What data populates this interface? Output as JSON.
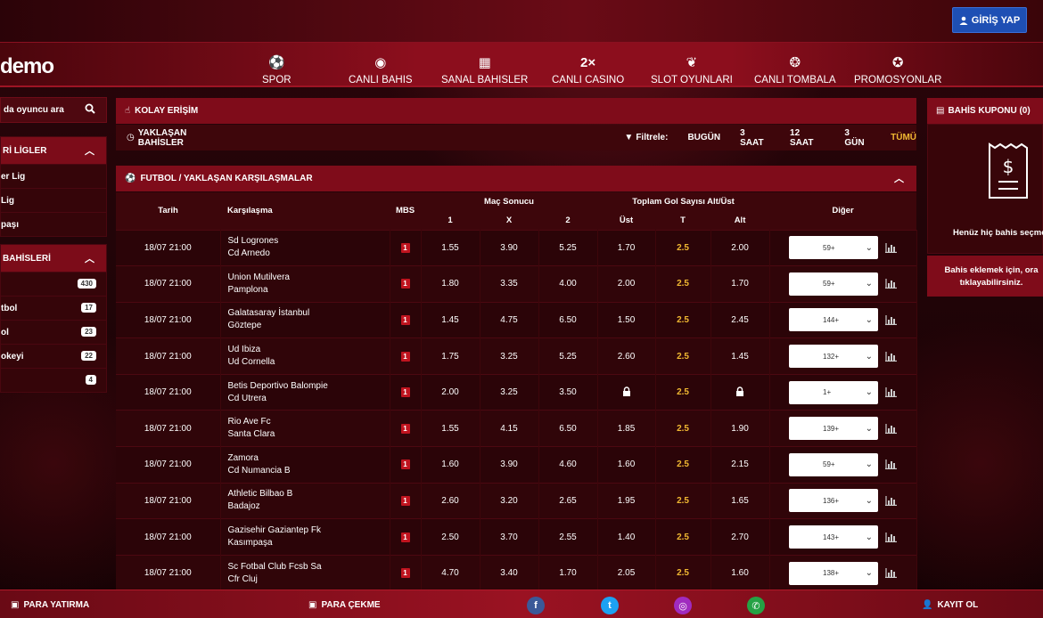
{
  "header": {
    "login_label": "GİRİŞ YAP",
    "logo_text": "demo"
  },
  "nav": {
    "items": [
      {
        "label": "SPOR",
        "icon": "soccer-ball-icon"
      },
      {
        "label": "CANLI BAHIS",
        "icon": "live-icon"
      },
      {
        "label": "SANAL BAHISLER",
        "icon": "virtual-icon"
      },
      {
        "label": "CANLI CASINO",
        "icon": "2x-icon"
      },
      {
        "label": "SLOT OYUNLARI",
        "icon": "cherry-icon"
      },
      {
        "label": "CANLI TOMBALA",
        "icon": "balls-icon"
      },
      {
        "label": "PROMOSYONLAR",
        "icon": "gift-icon"
      }
    ]
  },
  "sidebar": {
    "search_text": "da oyuncu ara",
    "leagues_title": "Rİ LİGLER",
    "leagues": [
      "er Lig",
      "Lig",
      "paşı"
    ],
    "bets_title": "BAHİSLERİ",
    "sports": [
      {
        "label": "",
        "count": "430"
      },
      {
        "label": "tbol",
        "count": "17"
      },
      {
        "label": "ol",
        "count": "23"
      },
      {
        "label": "okeyi",
        "count": "22"
      },
      {
        "label": "",
        "count": "4"
      }
    ]
  },
  "quick_access": {
    "title": "KOLAY ERİŞİM"
  },
  "upcoming": {
    "title": "YAKLAŞAN BAHİSLER",
    "filter_label": "Filtrele:",
    "filters": [
      "BUGÜN",
      "3 SAAT",
      "12 SAAT",
      "3 GÜN",
      "TÜMÜ"
    ],
    "active_filter": "TÜMÜ"
  },
  "matches_panel": {
    "title": "FUTBOL / YAKLAŞAN KARŞILAŞMALAR",
    "headers": {
      "date": "Tarih",
      "match": "Karşılaşma",
      "mbs": "MBS",
      "result": "Maç Sonucu",
      "r1": "1",
      "rx": "X",
      "r2": "2",
      "total": "Toplam Gol Sayısı Alt/Üst",
      "over": "Üst",
      "t": "T",
      "under": "Alt",
      "other": "Diğer"
    },
    "rows": [
      {
        "date": "18/07 21:00",
        "home": "Sd Logrones",
        "away": "Cd Arnedo",
        "mbs": "1",
        "o1": "1.55",
        "ox": "3.90",
        "o2": "5.25",
        "over": "1.70",
        "t": "2.5",
        "under": "2.00",
        "more": "59+"
      },
      {
        "date": "18/07 21:00",
        "home": "Union Mutilvera",
        "away": "Pamplona",
        "mbs": "1",
        "o1": "1.80",
        "ox": "3.35",
        "o2": "4.00",
        "over": "2.00",
        "t": "2.5",
        "under": "1.70",
        "more": "59+"
      },
      {
        "date": "18/07 21:00",
        "home": "Galatasaray İstanbul",
        "away": "Göztepe",
        "mbs": "1",
        "o1": "1.45",
        "ox": "4.75",
        "o2": "6.50",
        "over": "1.50",
        "t": "2.5",
        "under": "2.45",
        "more": "144+"
      },
      {
        "date": "18/07 21:00",
        "home": "Ud Ibiza",
        "away": "Ud Cornella",
        "mbs": "1",
        "o1": "1.75",
        "ox": "3.25",
        "o2": "5.25",
        "over": "2.60",
        "t": "2.5",
        "under": "1.45",
        "more": "132+"
      },
      {
        "date": "18/07 21:00",
        "home": "Betis Deportivo Balompie",
        "away": "Cd Utrera",
        "mbs": "1",
        "o1": "2.00",
        "ox": "3.25",
        "o2": "3.50",
        "over": "",
        "t": "2.5",
        "under": "",
        "more": "1+",
        "locked": true
      },
      {
        "date": "18/07 21:00",
        "home": "Rio Ave Fc",
        "away": "Santa Clara",
        "mbs": "1",
        "o1": "1.55",
        "ox": "4.15",
        "o2": "6.50",
        "over": "1.85",
        "t": "2.5",
        "under": "1.90",
        "more": "139+"
      },
      {
        "date": "18/07 21:00",
        "home": "Zamora",
        "away": "Cd Numancia B",
        "mbs": "1",
        "o1": "1.60",
        "ox": "3.90",
        "o2": "4.60",
        "over": "1.60",
        "t": "2.5",
        "under": "2.15",
        "more": "59+"
      },
      {
        "date": "18/07 21:00",
        "home": "Athletic Bilbao B",
        "away": "Badajoz",
        "mbs": "1",
        "o1": "2.60",
        "ox": "3.20",
        "o2": "2.65",
        "over": "1.95",
        "t": "2.5",
        "under": "1.65",
        "more": "136+"
      },
      {
        "date": "18/07 21:00",
        "home": "Gazisehir Gaziantep Fk",
        "away": "Kasımpaşa",
        "mbs": "1",
        "o1": "2.50",
        "ox": "3.70",
        "o2": "2.55",
        "over": "1.40",
        "t": "2.5",
        "under": "2.70",
        "more": "143+"
      },
      {
        "date": "18/07 21:00",
        "home": "Sc Fotbal Club Fcsb Sa",
        "away": "Cfr Cluj",
        "mbs": "1",
        "o1": "4.70",
        "ox": "3.40",
        "o2": "1.70",
        "over": "2.05",
        "t": "2.5",
        "under": "1.60",
        "more": "138+"
      }
    ]
  },
  "coupon": {
    "title": "BAHİS KUPONU (0)",
    "empty_text": "Henüz hiç bahis seçme",
    "hint_line1": "Bahis eklemek için, ora",
    "hint_line2": "tıklayabilirsiniz."
  },
  "footer": {
    "deposit": "PARA YATIRMA",
    "withdraw": "PARA ÇEKME",
    "register": "KAYIT OL"
  },
  "colors": {
    "accent": "#7f0c1a",
    "total_highlight": "#f0b832",
    "login": "#1e4fb4"
  }
}
